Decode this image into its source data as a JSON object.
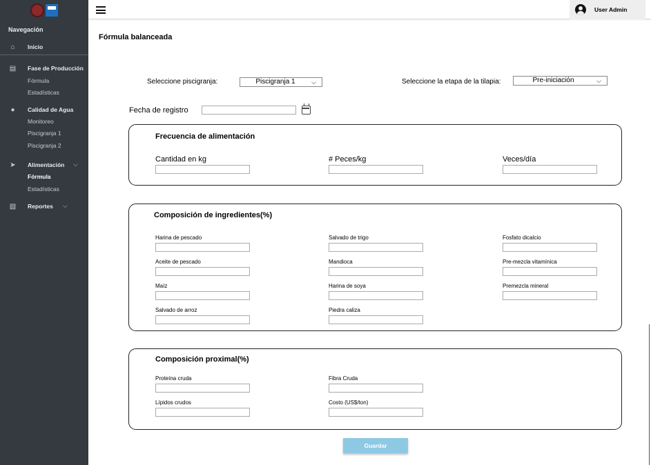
{
  "sidebar": {
    "nav_title": "Navegación",
    "inicio": "Inicio",
    "fase": {
      "label": "Fase de Producción",
      "subs": [
        "Fórmula",
        "Estadísticas"
      ]
    },
    "calidad": {
      "label": "Calidad de Agua",
      "subs": [
        "Monitoreo",
        "Piscigranja 1",
        "Piscigranja 2"
      ]
    },
    "alimentacion": {
      "label": "Alimentación",
      "subs": [
        "Fórmula",
        "Estadísticas"
      ],
      "active_sub": "Fórmula"
    },
    "reportes": {
      "label": "Reportes"
    },
    "icons": [
      "home-icon",
      "production-icon",
      "water-drop-icon",
      "fish-icon",
      "reports-icon"
    ]
  },
  "topbar": {
    "user": "User Admin"
  },
  "page": {
    "title": "Fórmula balanceada"
  },
  "selectors": {
    "pisci_label": "Seleccione piscigranja:",
    "pisci_value": "Piscigranja 1",
    "etapa_label": "Seleccione la etapa de la tilapia:",
    "etapa_value": "Pre-iniciación",
    "fecha_label": "Fecha de registro"
  },
  "frecuencia": {
    "title": "Frecuencia de alimentación",
    "fields": [
      "Cantidad en kg",
      "# Peces/kg",
      "Veces/día"
    ]
  },
  "composicion": {
    "title": "Composición de ingredientes(%)",
    "col1": [
      "Harina de pescado",
      "Aceite de pescado",
      "Maíz",
      "Salvado de arroz"
    ],
    "col2": [
      "Salvado de trigo",
      "Mandioca",
      "Harina de soya",
      "Piedra caliza"
    ],
    "col3": [
      "Fosfato dicalcio",
      "Pre-mezcla vitamínica",
      "Premezcla mineral"
    ]
  },
  "proximal": {
    "title": "Composición proximal(%)",
    "col1": [
      "Proteína cruda",
      "Lípidos crudos"
    ],
    "col2": [
      "Fibra Cruda",
      "Costo (US$/ton)"
    ]
  },
  "actions": {
    "save": "Guardar"
  },
  "colors": {
    "sidebar_bg": "#343a40",
    "save_button": "#8ec9e3"
  }
}
